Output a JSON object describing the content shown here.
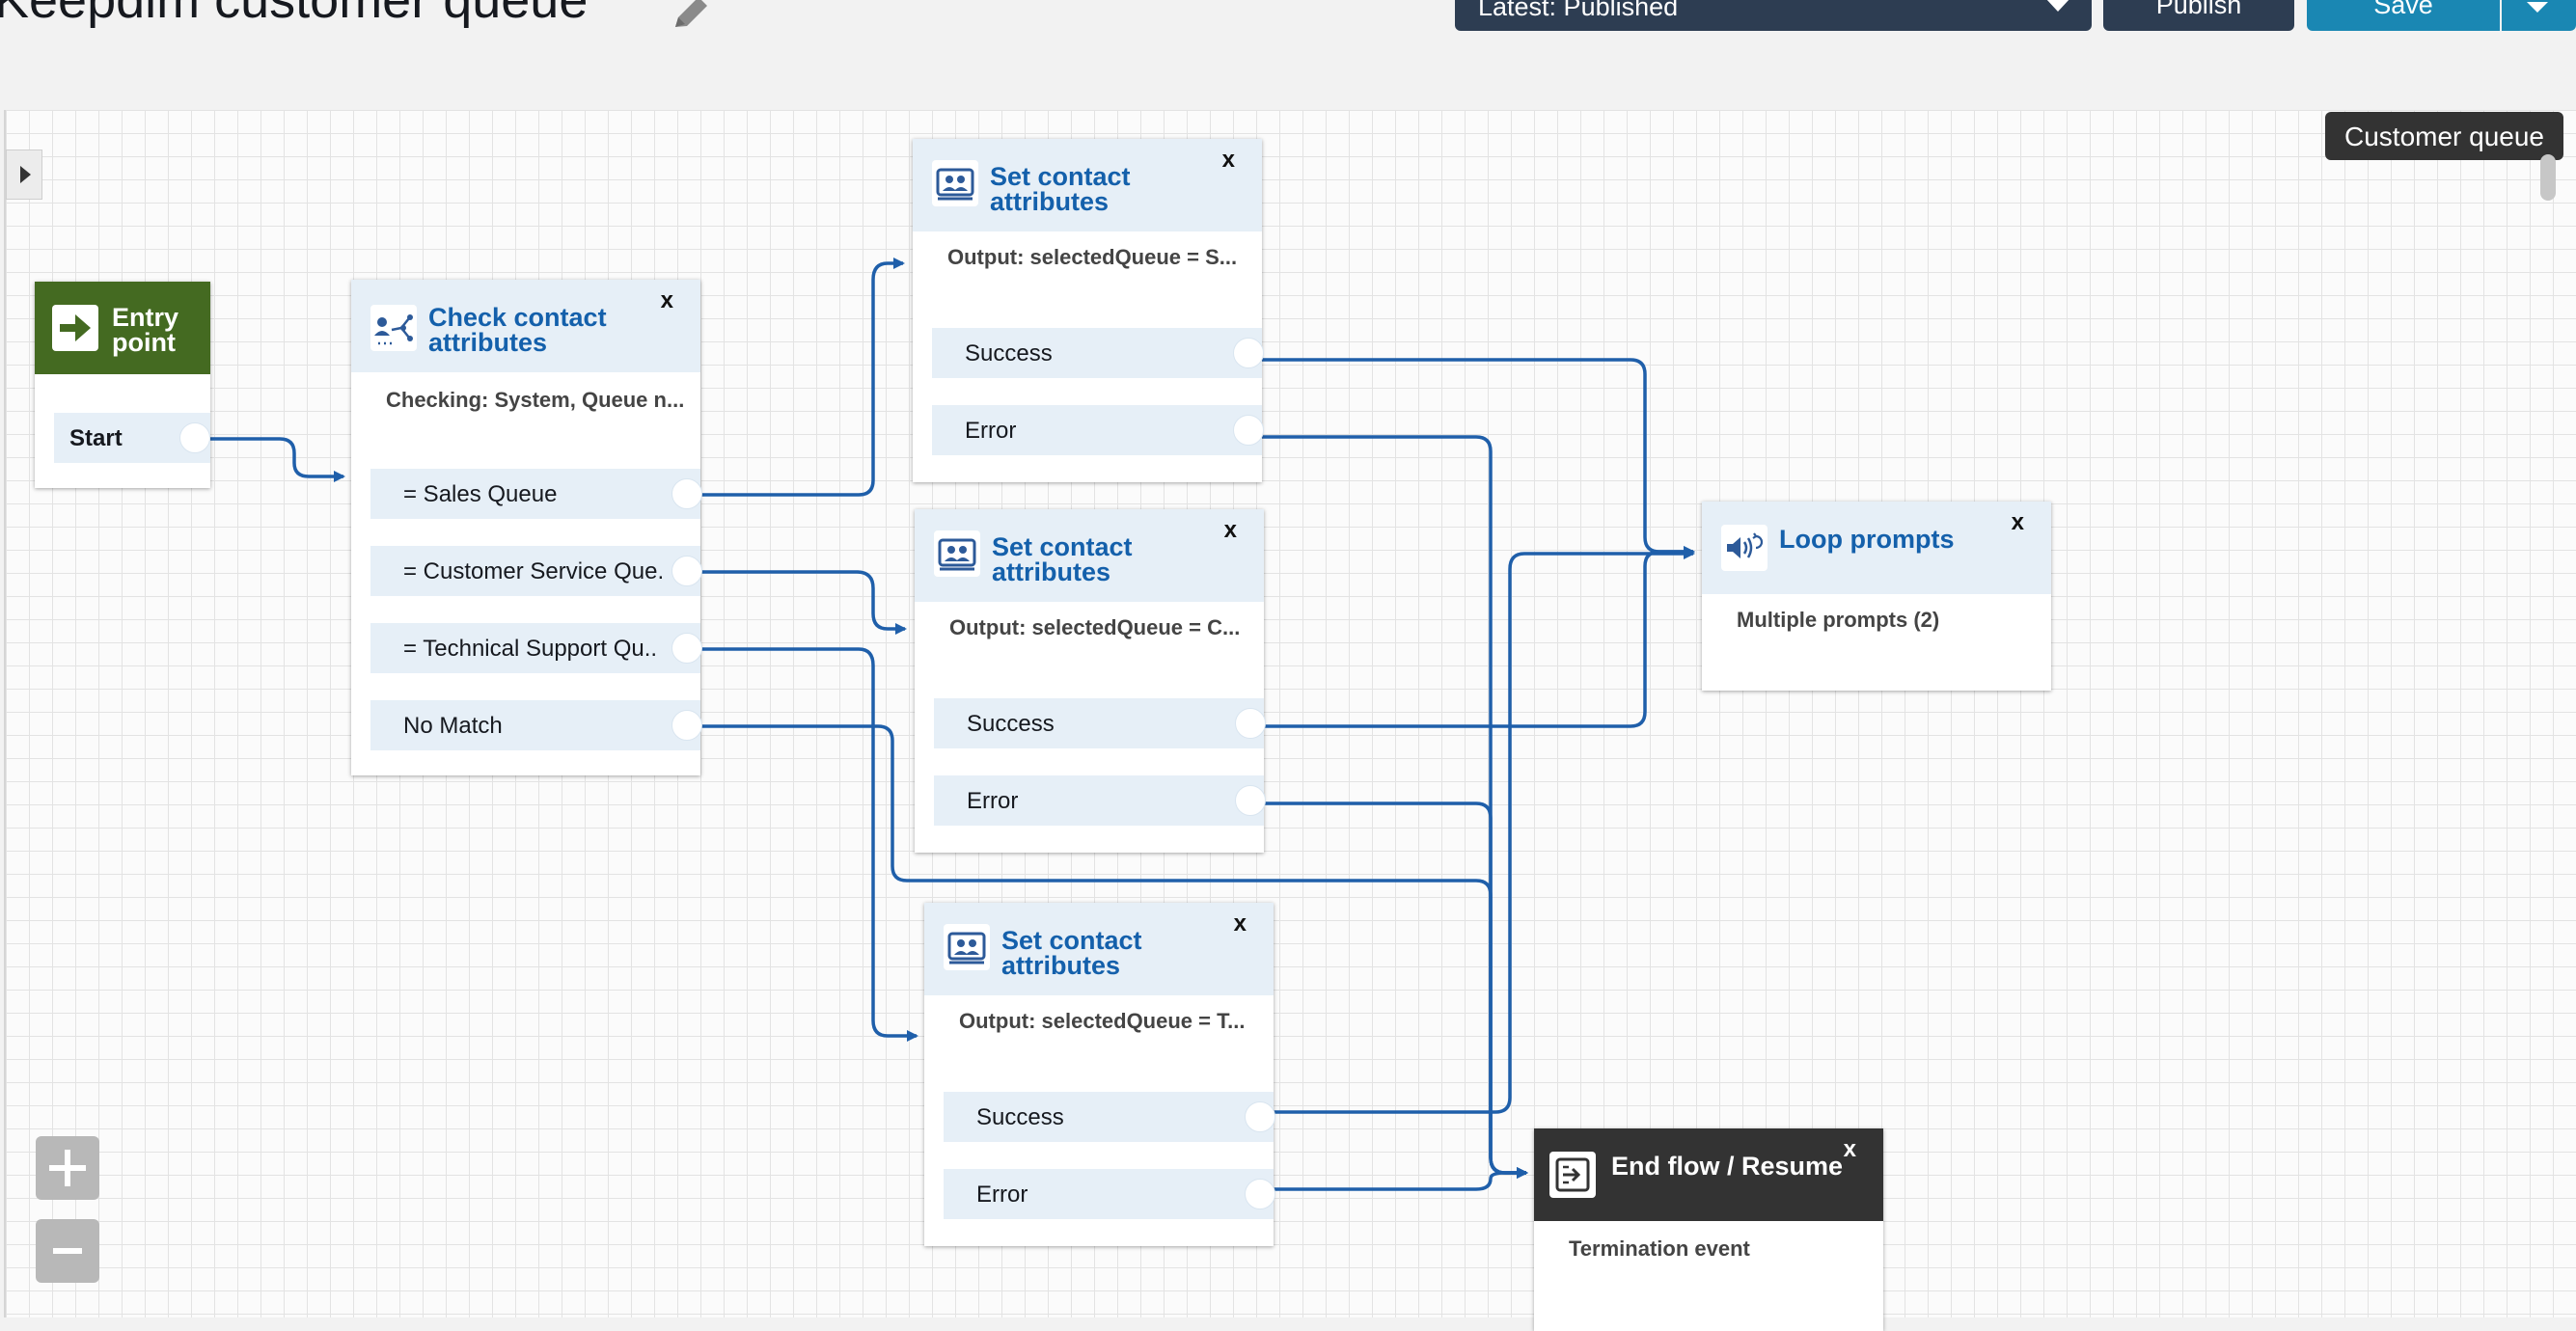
{
  "header": {
    "title": "Keepdim customer queue",
    "version_select": "Latest: Published",
    "publish_label": "Publish",
    "save_label": "Save"
  },
  "canvas": {
    "flow_badge": "Customer queue"
  },
  "blocks": {
    "entry": {
      "title": "Entry\npoint",
      "branch_start": "Start"
    },
    "check": {
      "title": "Check contact\nattributes",
      "close": "x",
      "desc": "Checking: System, Queue n...",
      "branches": [
        "= Sales Queue",
        "= Customer Service Que.",
        "= Technical Support Qu..",
        "No Match"
      ]
    },
    "set1": {
      "title": "Set contact\nattributes",
      "close": "x",
      "desc": "Output: selectedQueue = S...",
      "success": "Success",
      "error": "Error"
    },
    "set2": {
      "title": "Set contact\nattributes",
      "close": "x",
      "desc": "Output: selectedQueue = C...",
      "success": "Success",
      "error": "Error"
    },
    "set3": {
      "title": "Set contact\nattributes",
      "close": "x",
      "desc": "Output: selectedQueue = T...",
      "success": "Success",
      "error": "Error"
    },
    "loop": {
      "title": "Loop prompts",
      "close": "x",
      "desc": "Multiple prompts (2)"
    },
    "end": {
      "title": "End flow / Resume",
      "close": "x",
      "desc": "Termination event"
    }
  },
  "colors": {
    "accent": "#1460ab",
    "connector": "#1f5faa",
    "entry_header": "#446a21",
    "end_header": "#333333",
    "save_button": "#1a87b3",
    "dark_button": "#2d3d52"
  },
  "icons": [
    "edit-pencil-icon",
    "dropdown-caret-icon",
    "arrow-right-icon",
    "branch-icon",
    "contact-attributes-icon",
    "speaker-loop-icon",
    "end-flow-icon",
    "plus-icon",
    "minus-icon"
  ]
}
